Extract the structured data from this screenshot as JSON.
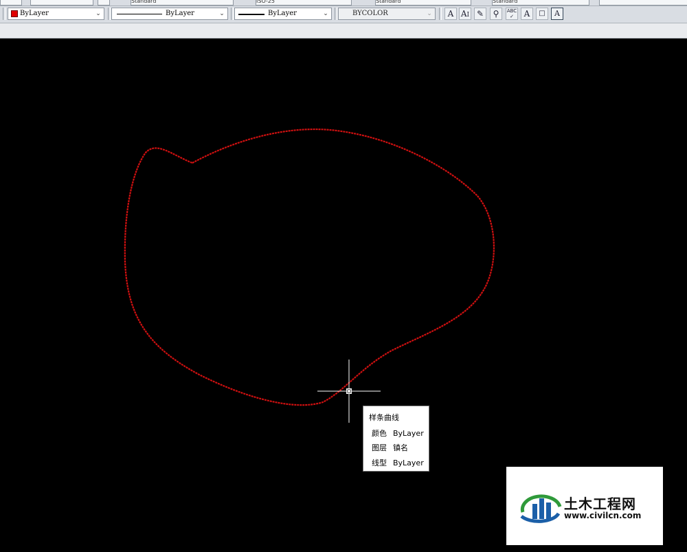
{
  "top_toolbar": {
    "text_style": "Standard",
    "dim_style": "ISO-25",
    "table_style": "Standard",
    "mleader_style": "Standard"
  },
  "properties_toolbar": {
    "color": {
      "value": "ByLayer",
      "swatch": "#e00000"
    },
    "linetype": {
      "value": "ByLayer"
    },
    "lineweight": {
      "value": "ByLayer"
    },
    "plot_style": {
      "value": "BYCOLOR"
    },
    "text_tools": [
      "multiline-text-icon",
      "text-edit-icon",
      "text-edit-2-icon",
      "find-text-icon",
      "spell-check-icon",
      "text-scale-icon",
      "justify-text-icon",
      "text-frame-icon"
    ]
  },
  "drawing": {
    "spline_color": "#d01010",
    "crosshair_color": "#ffffff",
    "canvas_background": "#000000"
  },
  "tooltip": {
    "title": "样条曲线",
    "rows": [
      {
        "key": "颜色",
        "value": "ByLayer"
      },
      {
        "key": "图层",
        "value": "镇名"
      },
      {
        "key": "线型",
        "value": "ByLayer"
      }
    ]
  },
  "watermark": {
    "name": "土木工程网",
    "url": "www.civilcn.com"
  }
}
